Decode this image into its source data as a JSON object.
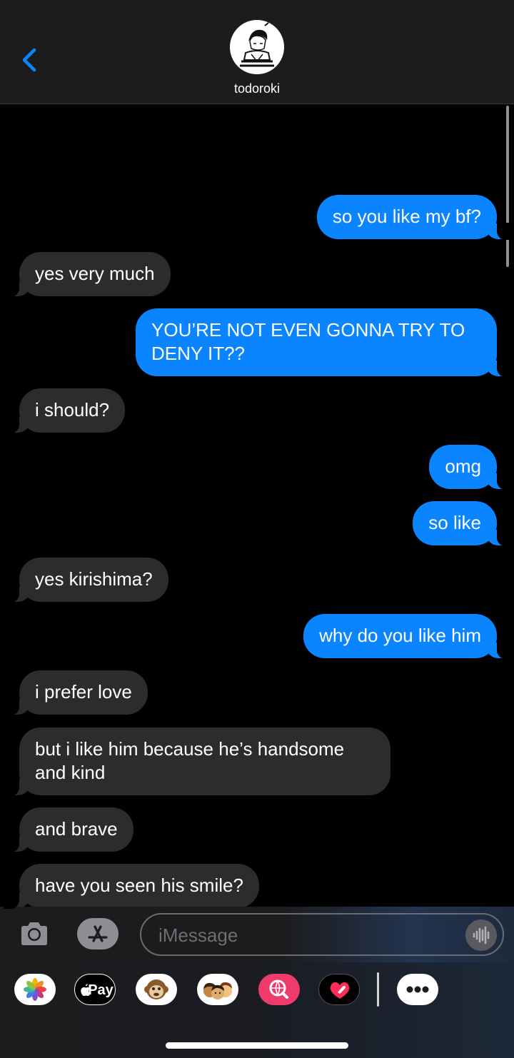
{
  "header": {
    "contact_name": "todoroki"
  },
  "messages": [
    {
      "text": "so you like my bf?",
      "from": "me"
    },
    {
      "text": "yes very much",
      "from": "them"
    },
    {
      "text": "YOU’RE NOT EVEN GONNA TRY TO",
      "text2": "DENY IT??",
      "from": "me"
    },
    {
      "text": "i should?",
      "from": "them"
    },
    {
      "text": "omg",
      "from": "me"
    },
    {
      "text": "so like",
      "from": "me"
    },
    {
      "text": "yes kirishima?",
      "from": "them"
    },
    {
      "text": "why do you like him",
      "from": "me"
    },
    {
      "text": "i prefer love",
      "from": "them"
    },
    {
      "text": "but i like him because he’s handsome",
      "text2": "and kind",
      "from": "them"
    },
    {
      "text": "and brave",
      "from": "them"
    },
    {
      "text": "have you seen his smile?",
      "from": "them"
    }
  ],
  "compose": {
    "placeholder": "iMessage"
  },
  "apps": {
    "pay_label": "Pay",
    "icons": [
      "photos-icon",
      "apple-pay-icon",
      "monkey-animoji-icon",
      "memoji-stickers-icon",
      "web-images-search-icon",
      "digital-touch-heart-icon",
      "more-icon"
    ]
  },
  "colors": {
    "sent_bubble": "#0a84ff",
    "received_bubble": "#2c2c2e",
    "background": "#000000",
    "header_background": "#1c1c1e"
  }
}
